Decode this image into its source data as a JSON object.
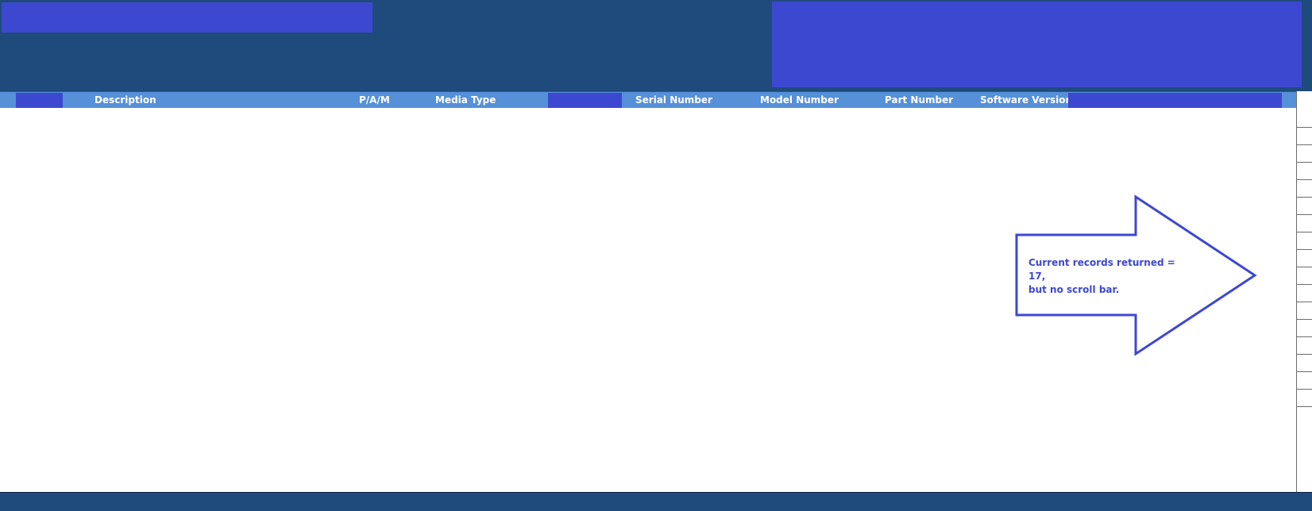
{
  "columns": {
    "description": "Description",
    "pam": "P/A/M",
    "media_type": "Media Type",
    "serial_number": "Serial Number",
    "model_number": "Model Number",
    "part_number": "Part Number",
    "software_version": "Software Version"
  },
  "callout": {
    "line1": "Current records returned = 17,",
    "line2": "but no scroll bar."
  },
  "colors": {
    "header_band": "#1f4b7c",
    "column_header": "#5590d8",
    "redaction": "#3d48d0",
    "annotation": "#3d48d0"
  }
}
